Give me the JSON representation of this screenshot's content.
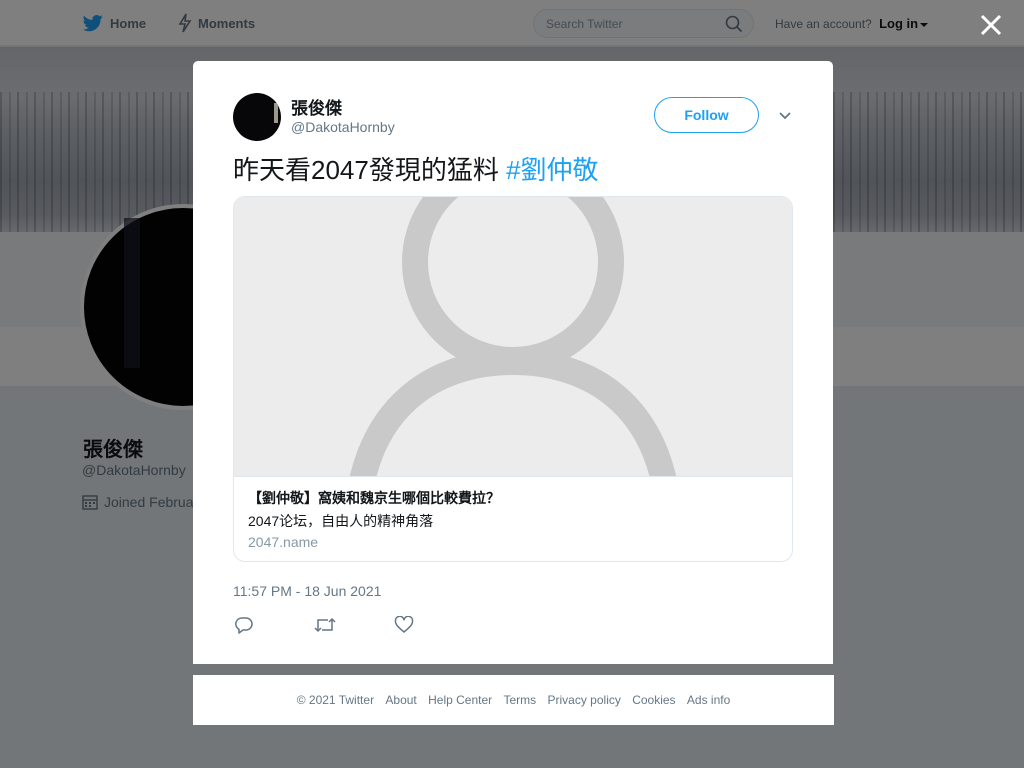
{
  "nav": {
    "home_label": "Home",
    "moments_label": "Moments",
    "search_placeholder": "Search Twitter",
    "account_prompt": "Have an account?",
    "login_label": "Log in"
  },
  "profile": {
    "name": "張俊傑",
    "handle": "@DakotaHornby",
    "joined": "Joined Februa"
  },
  "tweet": {
    "author_name": "張俊傑",
    "author_handle": "@DakotaHornby",
    "follow_label": "Follow",
    "text": "昨天看2047發現的猛料 ",
    "hashtag": "#劉仲敬",
    "card": {
      "title": "【劉仲敬】窩姨和魏京生哪個比較費拉？",
      "description": "2047论坛，自由人的精神角落",
      "domain": "2047.name"
    },
    "timestamp": "11:57 PM - 18 Jun 2021"
  },
  "footer": {
    "copyright": "© 2021 Twitter",
    "links": [
      "About",
      "Help Center",
      "Terms",
      "Privacy policy",
      "Cookies",
      "Ads info"
    ]
  },
  "colors": {
    "accent": "#1da1f2",
    "text_primary": "#14171a",
    "text_secondary": "#657786"
  },
  "icons": [
    "twitter-bird-icon",
    "lightning-icon",
    "search-icon",
    "close-icon",
    "chevron-down-icon",
    "reply-icon",
    "retweet-icon",
    "heart-icon",
    "calendar-icon",
    "placeholder-person-icon"
  ]
}
